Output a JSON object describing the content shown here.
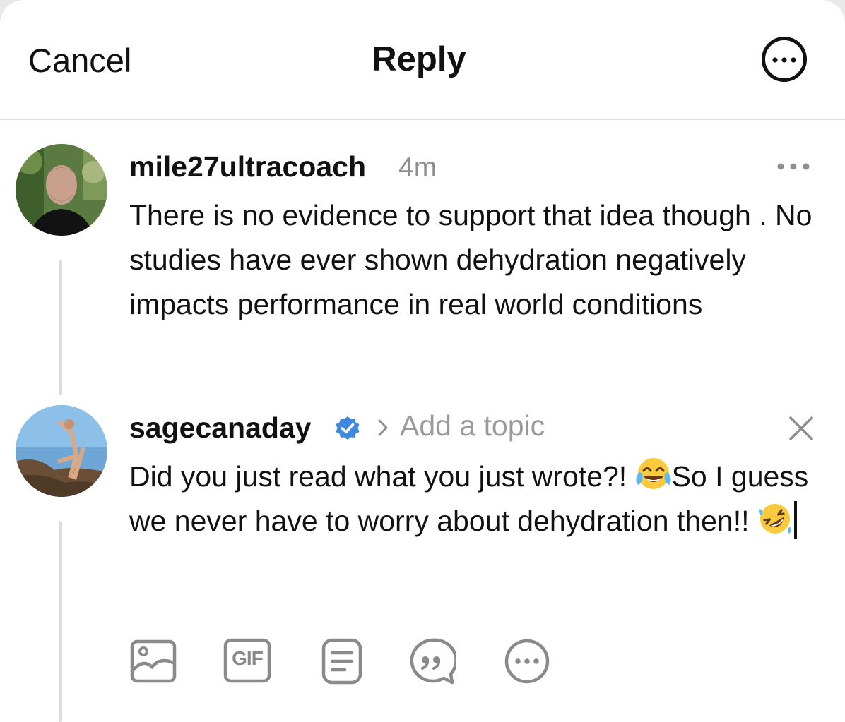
{
  "header": {
    "cancel_label": "Cancel",
    "title": "Reply"
  },
  "parent_post": {
    "username": "mile27ultracoach",
    "time": "4m",
    "text": "There is no evidence to support that idea though . No studies have ever shown dehydration negatively impacts performance in real world conditions"
  },
  "reply": {
    "username": "sagecanaday",
    "verified": true,
    "topic_placeholder": "Add a topic",
    "text_part1": "Did you just read what you just wrote?! ",
    "emoji1": "face-with-tears-of-joy",
    "text_part2": "So I guess we never have to worry about dehydration then!! ",
    "emoji2": "rolling-on-the-floor-laughing"
  },
  "toolbar": {
    "gif_label": "GIF",
    "icons": [
      "image-icon",
      "gif-icon",
      "poll-icon",
      "quote-icon",
      "more-icon"
    ]
  },
  "colors": {
    "verified_blue": "#3f88e0",
    "muted_gray": "#8e8e8e",
    "icon_gray": "#8a8a8a"
  }
}
